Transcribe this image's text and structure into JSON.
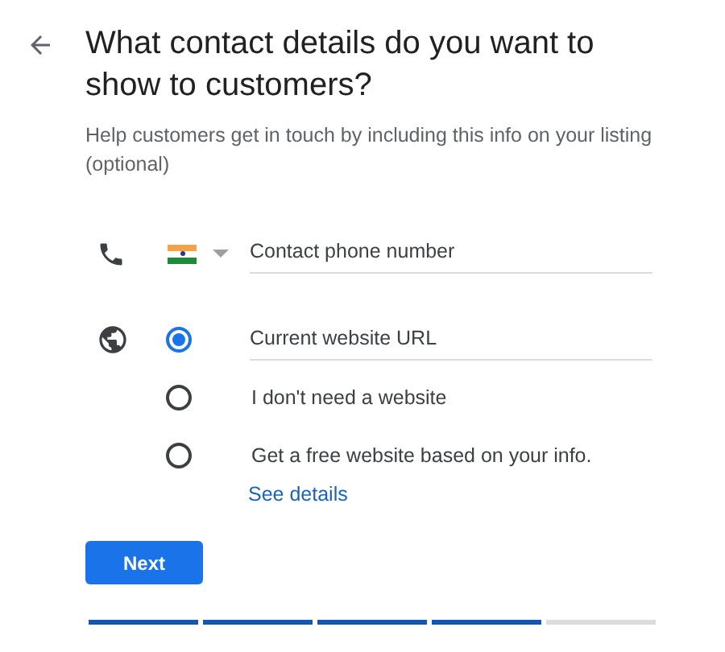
{
  "title": "What contact details do you want to show to customers?",
  "subtitle": "Help customers get in touch by including this info on your listing (optional)",
  "phone": {
    "placeholder": "Contact phone number"
  },
  "website_options": [
    {
      "kind": "field",
      "placeholder": "Current website URL",
      "selected": true
    },
    {
      "kind": "text",
      "label": "I don't need a website",
      "selected": false
    },
    {
      "kind": "text",
      "label": "Get a free website based on your info.",
      "selected": false
    }
  ],
  "see_details_link": "See details",
  "next_button": "Next",
  "progress_steps": [
    {
      "complete": true
    },
    {
      "complete": true
    },
    {
      "complete": true
    },
    {
      "complete": true
    },
    {
      "complete": false
    }
  ]
}
